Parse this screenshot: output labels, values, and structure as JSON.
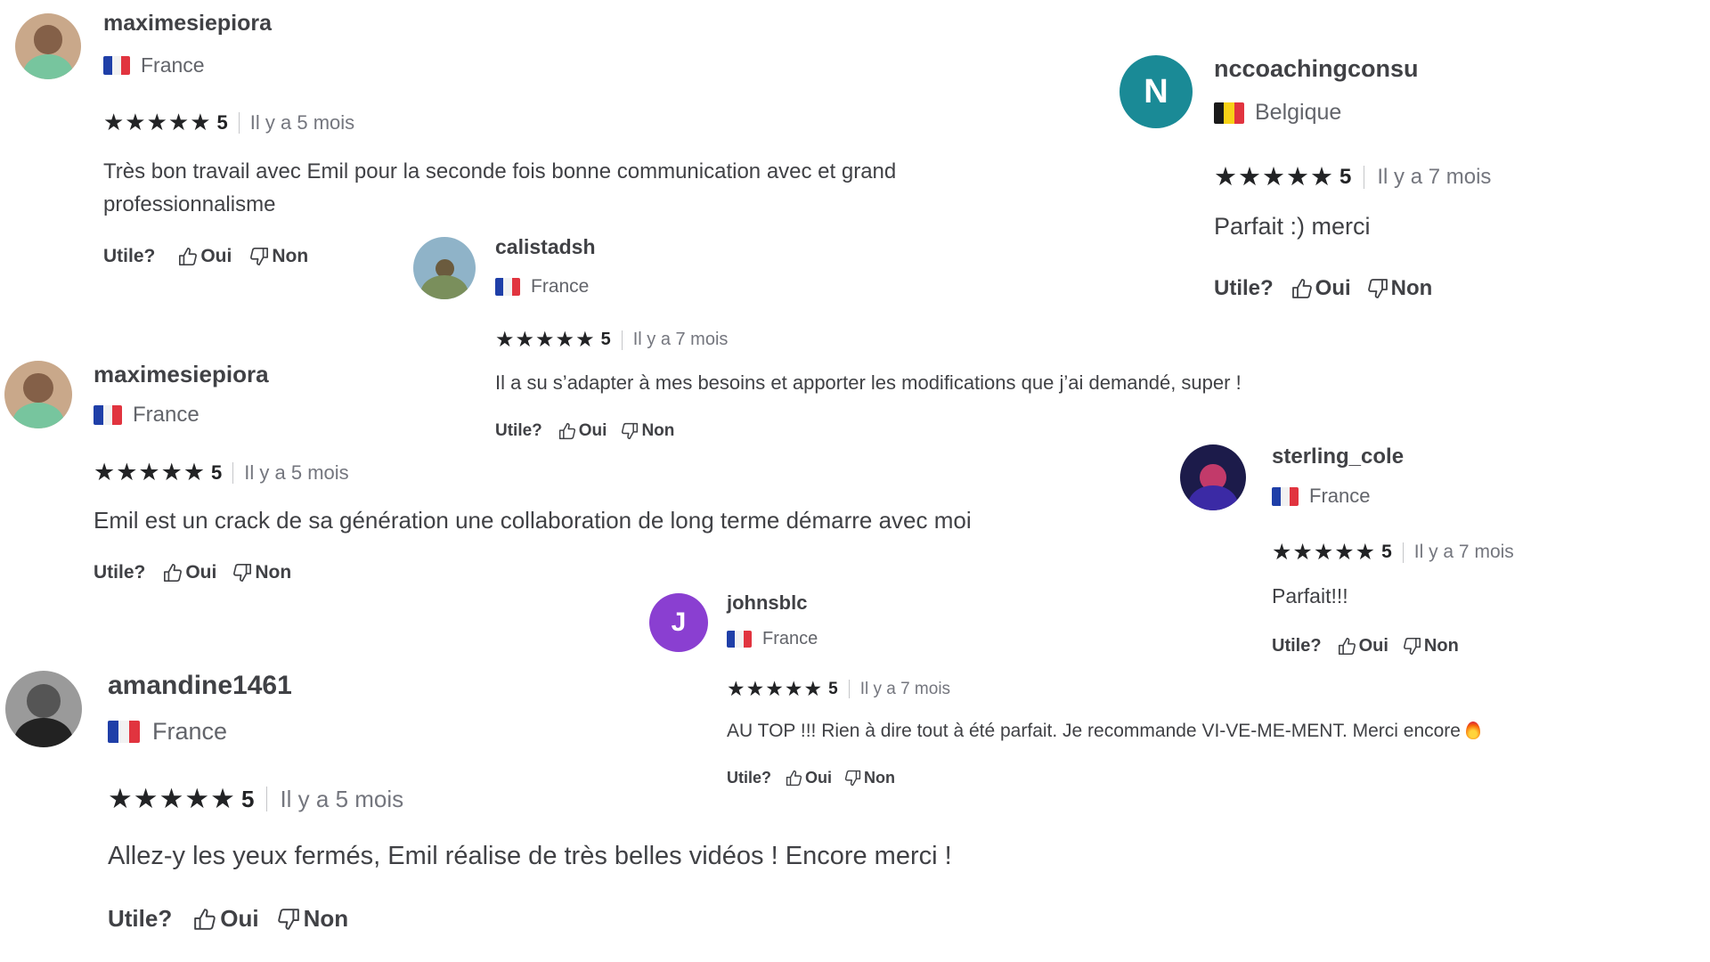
{
  "colors": {
    "star": "#222325",
    "text": "#404145",
    "muted": "#74767e",
    "avatar_teal": "#1a8a96",
    "avatar_purple": "#8a3fd1"
  },
  "icons": {
    "star": "star-icon",
    "thumbs_up": "thumbs-up-icon",
    "thumbs_down": "thumbs-down-icon",
    "fire": "fire-emoji"
  },
  "reviews": [
    {
      "username": "maximesiepiora",
      "country": "France",
      "flag": "france",
      "stars": "★★★★★",
      "rating": "5",
      "time": "Il y a 5 mois",
      "text_lines": [
        "Très bon travail avec Emil pour la seconde fois bonne communication avec et grand",
        "professionnalisme"
      ],
      "helpful_label": "Utile?",
      "yes_label": "Oui",
      "no_label": "Non"
    },
    {
      "username": "nccoachingconsu",
      "avatar_letter": "N",
      "country": "Belgique",
      "flag": "belgium",
      "stars": "★★★★★",
      "rating": "5",
      "time": "Il y a 7 mois",
      "text_lines": [
        "Parfait :) merci"
      ],
      "helpful_label": "Utile?",
      "yes_label": "Oui",
      "no_label": "Non"
    },
    {
      "username": "calistadsh",
      "country": "France",
      "flag": "france",
      "stars": "★★★★★",
      "rating": "5",
      "time": "Il y a 7 mois",
      "text_lines": [
        "Il a su s’adapter à mes besoins et apporter les modifications que j’ai demandé, super !"
      ],
      "helpful_label": "Utile?",
      "yes_label": "Oui",
      "no_label": "Non"
    },
    {
      "username": "maximesiepiora",
      "country": "France",
      "flag": "france",
      "stars": "★★★★★",
      "rating": "5",
      "time": "Il y a 5 mois",
      "text_lines": [
        "Emil est un crack de sa génération une collaboration de long terme démarre avec moi"
      ],
      "helpful_label": "Utile?",
      "yes_label": "Oui",
      "no_label": "Non"
    },
    {
      "username": "sterling_cole",
      "country": "France",
      "flag": "france",
      "stars": "★★★★★",
      "rating": "5",
      "time": "Il y a 7 mois",
      "text_lines": [
        "Parfait!!!"
      ],
      "helpful_label": "Utile?",
      "yes_label": "Oui",
      "no_label": "Non"
    },
    {
      "username": "johnsblc",
      "avatar_letter": "J",
      "country": "France",
      "flag": "france",
      "stars": "★★★★★",
      "rating": "5",
      "time": "Il y a 7 mois",
      "text_lines": [
        "AU TOP !!! Rien à dire tout à été parfait. Je recommande VI-VE-ME-MENT. Merci encore"
      ],
      "helpful_label": "Utile?",
      "yes_label": "Oui",
      "no_label": "Non"
    },
    {
      "username": "amandine1461",
      "country": "France",
      "flag": "france",
      "stars": "★★★★★",
      "rating": "5",
      "time": "Il y a 5 mois",
      "text_lines": [
        "Allez-y les yeux fermés, Emil réalise de très belles vidéos ! Encore merci !"
      ],
      "helpful_label": "Utile?",
      "yes_label": "Oui",
      "no_label": "Non"
    }
  ]
}
